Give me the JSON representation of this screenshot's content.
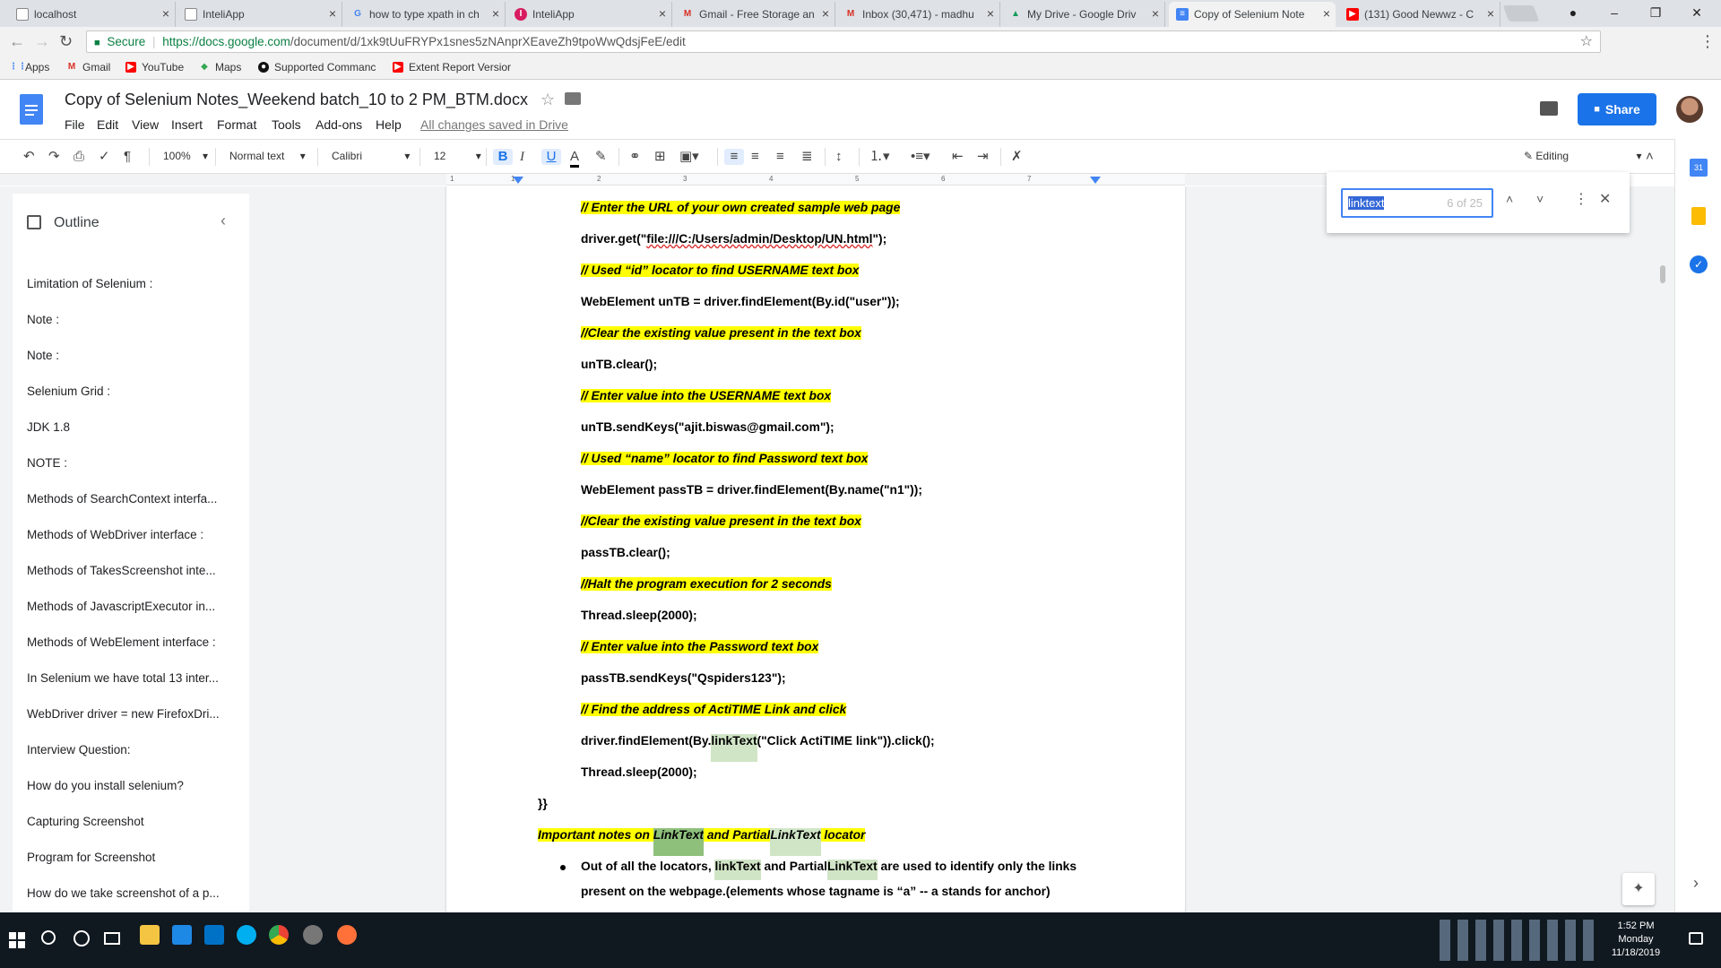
{
  "browser": {
    "tabs": [
      {
        "title": "localhost",
        "icon": "page-icon"
      },
      {
        "title": "InteliApp",
        "icon": "page-icon"
      },
      {
        "title": "how to type xpath in ch",
        "icon": "google-icon"
      },
      {
        "title": "InteliApp",
        "icon": "inteliapp-icon"
      },
      {
        "title": "Gmail - Free Storage an",
        "icon": "gmail-icon"
      },
      {
        "title": "Inbox (30,471) - madhu",
        "icon": "gmail-icon"
      },
      {
        "title": "My Drive - Google Driv",
        "icon": "drive-icon"
      },
      {
        "title": "Copy of Selenium Note",
        "icon": "docs-icon"
      },
      {
        "title": "(131) Good Newwz - C",
        "icon": "youtube-icon"
      }
    ],
    "secure_label": "Secure",
    "url_host": "https://docs.google.com",
    "url_path": "/document/d/1xk9tUuFRYPx1snes5zNAnprXEaveZh9tpoWwQdsjFeE/edit",
    "bookmarks": [
      "Apps",
      "Gmail",
      "YouTube",
      "Maps",
      "Supported Commanc",
      "Extent Report Versior"
    ]
  },
  "doc": {
    "title": "Copy of Selenium Notes_Weekend batch_10 to 2 PM_BTM.docx",
    "menus": [
      "File",
      "Edit",
      "View",
      "Insert",
      "Format",
      "Tools",
      "Add-ons",
      "Help"
    ],
    "save_status": "All changes saved in Drive",
    "share_label": "Share"
  },
  "toolbar": {
    "zoom": "100%",
    "style": "Normal text",
    "font": "Calibri",
    "size": "12",
    "mode": "Editing"
  },
  "ruler": {
    "marks": [
      "1",
      "1",
      "2",
      "3",
      "4",
      "5",
      "6",
      "7"
    ]
  },
  "outline": {
    "title": "Outline",
    "items": [
      "Limitation of Selenium :",
      "Note :",
      "Note :",
      "Selenium Grid :",
      "JDK 1.8",
      "NOTE :",
      "Methods of SearchContext interfa...",
      "Methods of WebDriver interface :",
      "Methods of TakesScreenshot inte...",
      "Methods of JavascriptExecutor in...",
      "Methods of WebElement interface :",
      "In Selenium we have total 13 inter...",
      "WebDriver driver = new FirefoxDri...",
      "Interview Question:",
      "How do you install selenium?",
      "Capturing Screenshot",
      "Program for Screenshot",
      "How do we take screenshot of a p..."
    ]
  },
  "content": {
    "l1": "// Enter the URL of your own created sample web page",
    "l2a": "driver.get(\"",
    "l2b": "file:///C:/Users/admin/Desktop/UN.html",
    "l2c": "\");",
    "l3": "// Used “id” locator to find USERNAME text box",
    "l4": "WebElement unTB = driver.findElement(By.id(\"user\"));",
    "l5": "//Clear the existing value present in the text box",
    "l6": "unTB.clear();",
    "l7": "// Enter value into the USERNAME text box",
    "l8": "unTB.sendKeys(\"ajit.biswas@gmail.com\");",
    "l9": "// Used “name” locator to find Password text box",
    "l10": "WebElement passTB = driver.findElement(By.name(\"n1\"));",
    "l11": "//Clear the existing value present in the text box",
    "l12": "passTB.clear();",
    "l13": "//Halt the program execution for 2 seconds",
    "l14": "Thread.sleep(2000);",
    "l15": "// Enter value into the Password text box",
    "l16": "passTB.sendKeys(\"Qspiders123\");",
    "l17": "// Find the address of ActiTIME Link and click",
    "l18a": "driver.findElement(By.",
    "l18b": "linkText",
    "l18c": "(\"Click ActiTIME link\")).click();",
    "l19": "Thread.sleep(2000);",
    "l20": "}}",
    "l21a": "Important notes on ",
    "l21b": "LinkText",
    "l21c": " and Partial",
    "l21d": "LinkText",
    "l21e": " locator",
    "l22a": "Out of all the locators, ",
    "l22b": "linkText",
    "l22c": " and Partial",
    "l22d": "LinkText",
    "l22e": " are used to identify only the links",
    "l23": "present on the webpage.(elements whose tagname is “a” -- a stands for anchor)"
  },
  "find": {
    "query": "linktext",
    "count": "6 of 25"
  },
  "taskbar": {
    "time": "1:52 PM",
    "day": "Monday",
    "date": "11/18/2019"
  },
  "colors": {
    "highlight_yellow": "#ffff00",
    "match_green": "#d0e5c6",
    "current_match_green": "#8ec07c",
    "share_blue": "#1a73e8"
  }
}
